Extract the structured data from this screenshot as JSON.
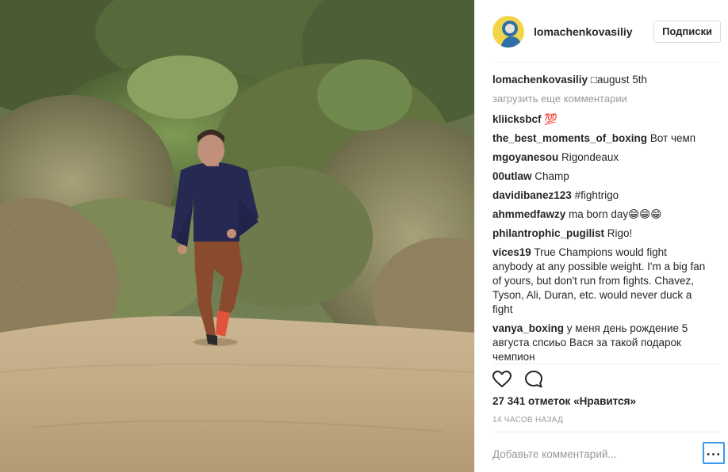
{
  "post": {
    "author": "lomachenkovasiliy",
    "follow_label": "Подписки",
    "caption": {
      "username": "lomachenkovasiliy",
      "text": "□august 5th"
    },
    "load_more_label": "загрузить еще комментарии",
    "comments": [
      {
        "username": "kliicksbcf",
        "text": "💯"
      },
      {
        "username": "the_best_moments_of_boxing",
        "text": "Вот чемп"
      },
      {
        "username": "mgoyanesou",
        "text": "Rigondeaux"
      },
      {
        "username": "00utlaw",
        "text": "Champ"
      },
      {
        "username": "davidibanez123",
        "text": "#fightrigo"
      },
      {
        "username": "ahmmedfawzy",
        "text": "ma born day😁😁😁"
      },
      {
        "username": "philantrophic_pugilist",
        "text": "Rigo!"
      },
      {
        "username": "vices19",
        "text": "True Champions would fight anybody at any possible weight. I'm a big fan of yours, but don't run from fights. Chavez, Tyson, Ali, Duran, etc. would never duck a fight"
      },
      {
        "username": "vanya_boxing",
        "text": "у меня день рождение 5 августа спсиьо Вася за такой подарок чемпион"
      }
    ],
    "likes_label": "27 341 отметок «Нравится»",
    "time_label": "14 ЧАСОВ НАЗАД",
    "comment_placeholder": "Добавьте комментарий...",
    "more_label": "...",
    "icons": {
      "like": "heart-icon",
      "comment": "comment-bubble-icon"
    },
    "colors": {
      "link": "#003569",
      "muted": "#999999",
      "text": "#262626",
      "focus": "#3897f0"
    }
  }
}
